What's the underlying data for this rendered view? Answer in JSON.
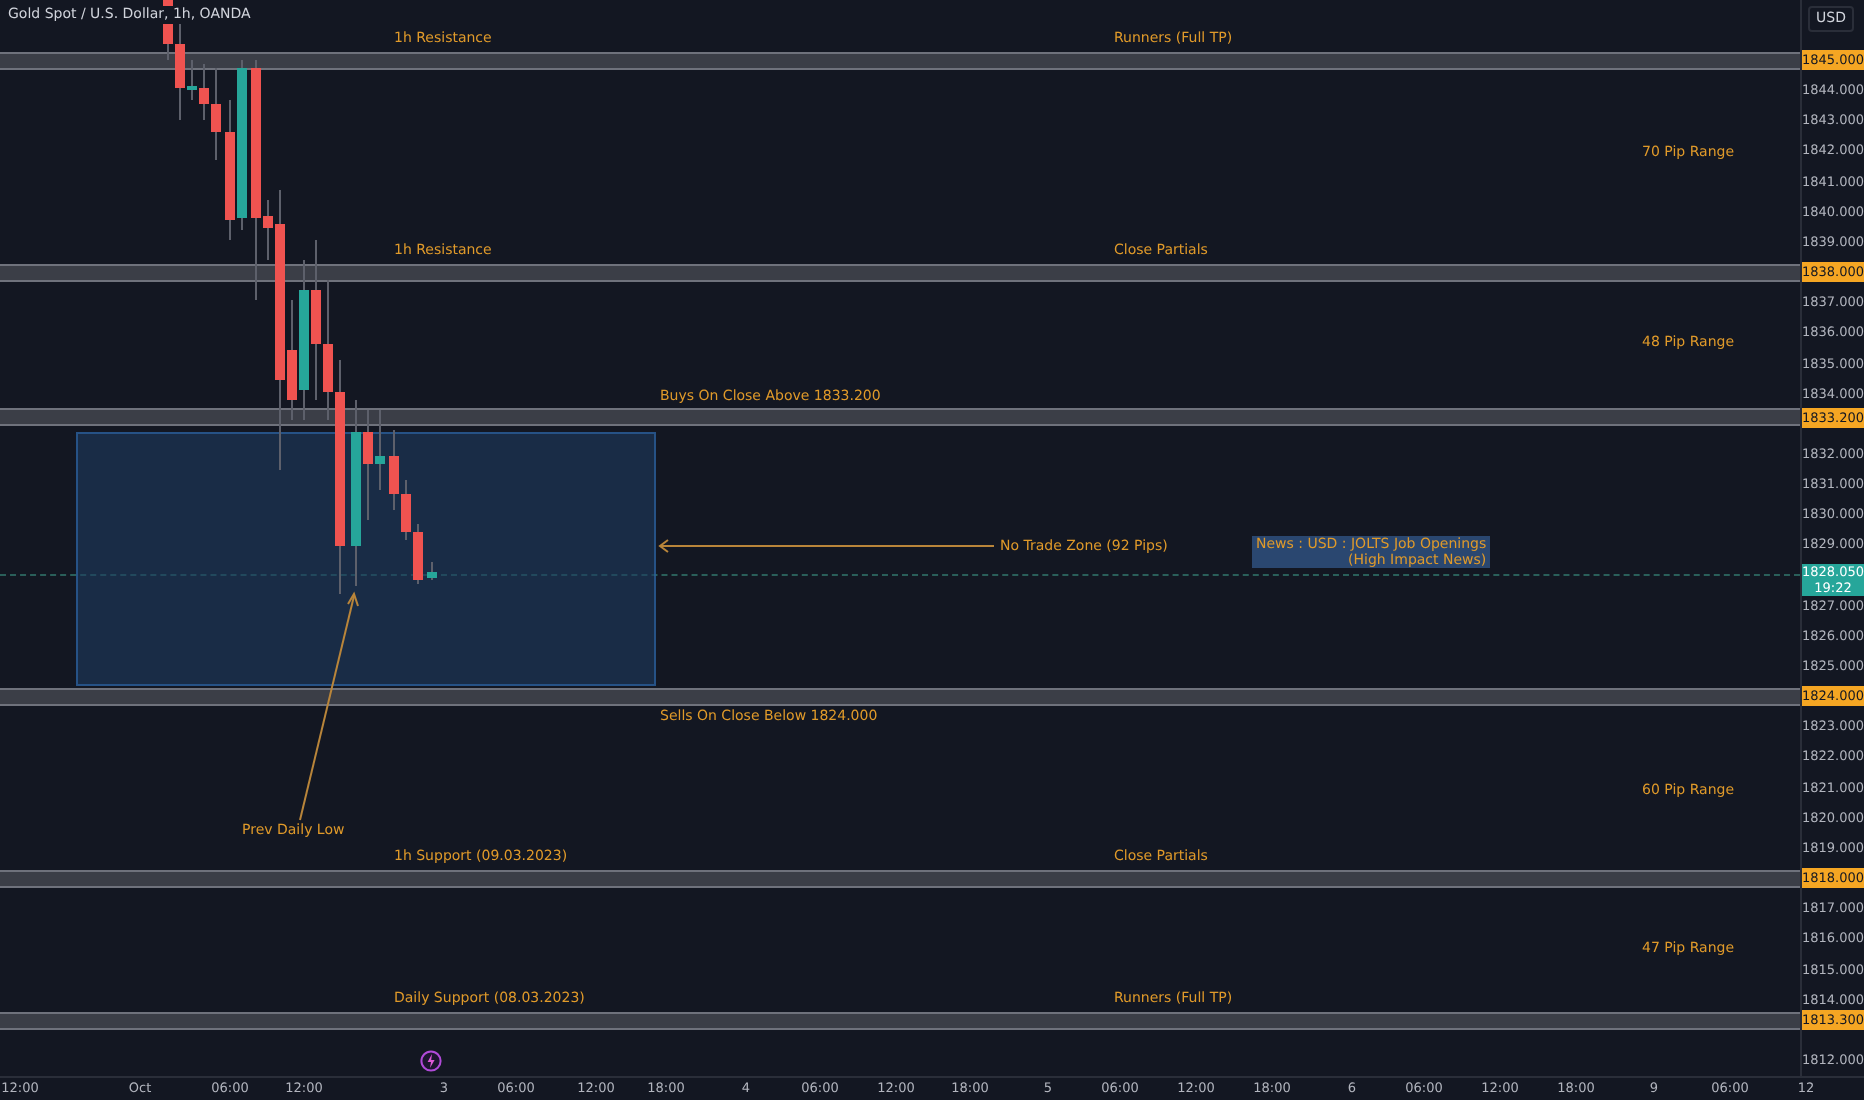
{
  "header": {
    "symbol": "Gold Spot / U.S. Dollar, 1h, OANDA"
  },
  "currency": "USD",
  "price_axis": [
    {
      "label": "1845.000",
      "kind": "level"
    },
    {
      "label": "1844.000",
      "kind": "tick"
    },
    {
      "label": "1843.000",
      "kind": "tick"
    },
    {
      "label": "1842.000",
      "kind": "tick"
    },
    {
      "label": "1841.000",
      "kind": "tick"
    },
    {
      "label": "1840.000",
      "kind": "tick"
    },
    {
      "label": "1839.000",
      "kind": "tick"
    },
    {
      "label": "1838.000",
      "kind": "level"
    },
    {
      "label": "1837.000",
      "kind": "tick"
    },
    {
      "label": "1836.000",
      "kind": "tick"
    },
    {
      "label": "1835.000",
      "kind": "tick"
    },
    {
      "label": "1834.000",
      "kind": "tick"
    },
    {
      "label": "1833.200",
      "kind": "level"
    },
    {
      "label": "1832.000",
      "kind": "tick"
    },
    {
      "label": "1831.000",
      "kind": "tick"
    },
    {
      "label": "1830.000",
      "kind": "tick"
    },
    {
      "label": "1829.000",
      "kind": "tick"
    },
    {
      "label": "1827.000",
      "kind": "tick"
    },
    {
      "label": "1826.000",
      "kind": "tick"
    },
    {
      "label": "1825.000",
      "kind": "tick"
    },
    {
      "label": "1824.000",
      "kind": "level"
    },
    {
      "label": "1823.000",
      "kind": "tick"
    },
    {
      "label": "1822.000",
      "kind": "tick"
    },
    {
      "label": "1821.000",
      "kind": "tick"
    },
    {
      "label": "1820.000",
      "kind": "tick"
    },
    {
      "label": "1819.000",
      "kind": "tick"
    },
    {
      "label": "1818.000",
      "kind": "level"
    },
    {
      "label": "1817.000",
      "kind": "tick"
    },
    {
      "label": "1816.000",
      "kind": "tick"
    },
    {
      "label": "1815.000",
      "kind": "tick"
    },
    {
      "label": "1814.000",
      "kind": "tick"
    },
    {
      "label": "1813.300",
      "kind": "level"
    },
    {
      "label": "1812.000",
      "kind": "tick"
    }
  ],
  "current_price": {
    "price": "1828.050",
    "countdown": "19:22"
  },
  "levels": [
    {
      "left_label": "1h Resistance",
      "right_label": "Runners (Full TP)"
    },
    {
      "left_label": "1h Resistance",
      "right_label": "Close Partials"
    },
    {
      "left_label": "Buys On Close Above 1833.200"
    },
    {
      "left_label": "Sells On Close Below 1824.000"
    },
    {
      "left_label": "1h Support (09.03.2023)",
      "right_label": "Close Partials"
    },
    {
      "left_label": "Daily Support (08.03.2023)",
      "right_label": "Runners (Full TP)"
    }
  ],
  "pip_ranges": [
    "70 Pip Range",
    "48 Pip Range",
    "60 Pip Range",
    "47 Pip Range"
  ],
  "no_trade_zone": {
    "label": "No Trade Zone (92 Pips)"
  },
  "news": {
    "lines": [
      "News : USD : JOLTS Job Openings",
      "(High Impact News)"
    ]
  },
  "prev_daily_low": "Prev Daily Low",
  "time_axis": [
    "12:00",
    "Oct",
    "06:00",
    "12:00",
    "3",
    "06:00",
    "12:00",
    "18:00",
    "4",
    "06:00",
    "12:00",
    "18:00",
    "5",
    "06:00",
    "12:00",
    "18:00",
    "6",
    "06:00",
    "12:00",
    "18:00",
    "9",
    "06:00",
    "12"
  ]
}
